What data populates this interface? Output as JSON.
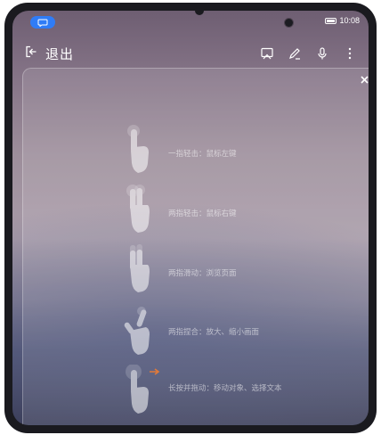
{
  "status_bar": {
    "time": "10:08"
  },
  "toolbar": {
    "exit_label": "退出",
    "icons": [
      "screen-cast-icon",
      "pen-icon",
      "microphone-icon",
      "more-vertical-icon"
    ]
  },
  "gestures": [
    {
      "label": "一指轻击：鼠标左键",
      "icon": "one-finger-tap-icon"
    },
    {
      "label": "两指轻击：鼠标右键",
      "icon": "two-finger-tap-icon"
    },
    {
      "label": "两指滑动：浏览页面",
      "icon": "two-finger-scroll-icon"
    },
    {
      "label": "两指捏合：放大、缩小画面",
      "icon": "pinch-zoom-icon"
    },
    {
      "label": "长按并拖动：移动对象、选择文本",
      "icon": "long-press-drag-icon"
    }
  ],
  "colors": {
    "accent": "#2f7cf6",
    "arrow": "#e07a3a"
  }
}
